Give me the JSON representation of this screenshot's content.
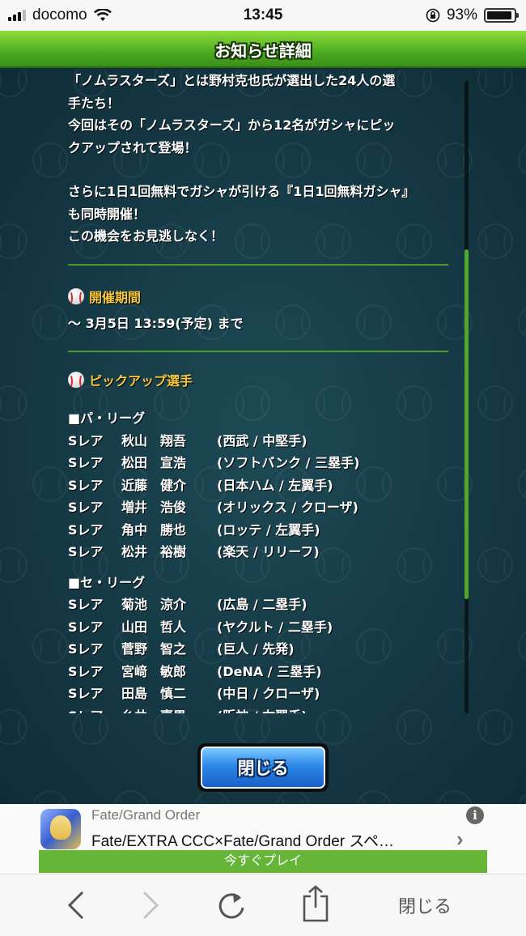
{
  "status_bar": {
    "carrier": "docomo",
    "time": "13:45",
    "battery": "93%",
    "battery_level": 0.93
  },
  "header": {
    "title": "お知らせ詳細"
  },
  "notice": {
    "intro": [
      "「ノムラスターズ」とは野村克也氏が選出した24人の選",
      "手たち！",
      "今回はその「ノムラスターズ」から12名がガシャにピッ",
      "クアップされて登場！"
    ],
    "intro2": [
      "さらに1日1回無料でガシャが引ける『1日1回無料ガシャ』",
      "も同時開催！",
      "この機会をお見逃しなく！"
    ],
    "period": {
      "heading": "開催期間",
      "text": "～ 3月5日 13:59(予定) まで"
    },
    "pickup": {
      "heading": "ピックアップ選手",
      "leagues": [
        {
          "name": "■パ・リーグ",
          "players": [
            {
              "rarity": "Sレア",
              "name": "秋山　翔吾",
              "team": "(西武 / 中堅手)"
            },
            {
              "rarity": "Sレア",
              "name": "松田　宣浩",
              "team": "(ソフトバンク / 三塁手)"
            },
            {
              "rarity": "Sレア",
              "name": "近藤　健介",
              "team": "(日本ハム / 左翼手)"
            },
            {
              "rarity": "Sレア",
              "name": "増井　浩俊",
              "team": "(オリックス / クローザ)"
            },
            {
              "rarity": "Sレア",
              "name": "角中　勝也",
              "team": "(ロッテ / 左翼手)"
            },
            {
              "rarity": "Sレア",
              "name": "松井　裕樹",
              "team": "(楽天 / リリーフ)"
            }
          ]
        },
        {
          "name": "■セ・リーグ",
          "players": [
            {
              "rarity": "Sレア",
              "name": "菊池　涼介",
              "team": "(広島 / 二塁手)"
            },
            {
              "rarity": "Sレア",
              "name": "山田　哲人",
              "team": "(ヤクルト / 二塁手)"
            },
            {
              "rarity": "Sレア",
              "name": "菅野　智之",
              "team": "(巨人 / 先発)"
            },
            {
              "rarity": "Sレア",
              "name": "宮﨑　敏郎",
              "team": "(DeNA / 三塁手)"
            },
            {
              "rarity": "Sレア",
              "name": "田島　慎二",
              "team": "(中日 / クローザ)"
            },
            {
              "rarity": "Sレア",
              "name": "糸井　嘉男",
              "team": "(阪神 / 右翼手)"
            }
          ]
        }
      ]
    },
    "close_label": "閉じる"
  },
  "ad": {
    "advertiser": "Fate/Grand Order",
    "title": "Fate/EXTRA CCC×Fate/Grand Order スペ…",
    "cta": "今すぐプレイ",
    "info_glyph": "i",
    "chevron": "›"
  },
  "toolbar": {
    "close_label": "閉じる"
  },
  "colors": {
    "header_green": "#4cab21",
    "section_heading": "#f7c93a",
    "divider": "#4e9a2a",
    "button_blue": "#2c87e8",
    "cta_green": "#66b539"
  },
  "icons": [
    "signal-icon",
    "wifi-icon",
    "orientation-lock-icon",
    "battery-icon",
    "baseball-icon",
    "info-icon",
    "chevron-right-icon",
    "back-icon",
    "forward-icon",
    "reload-icon",
    "share-icon"
  ]
}
